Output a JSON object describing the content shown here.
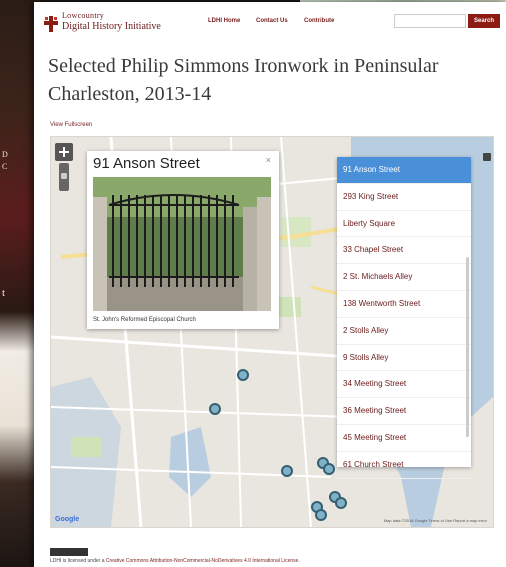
{
  "backdrop": {
    "strip_lines": [
      "D",
      "C",
      "t"
    ]
  },
  "header": {
    "logo_line1": "Lowcountry",
    "logo_line2": "Digital History Initiative",
    "nav": [
      "LDHI Home",
      "Contact Us",
      "Contribute"
    ],
    "search_placeholder": "",
    "search_button": "Search"
  },
  "page": {
    "title": "Selected Philip Simmons Ironwork in Peninsular Charleston, 2013-14",
    "fullscreen_link": "View Fullscreen"
  },
  "map": {
    "popup": {
      "title": "91 Anson Street",
      "close": "×",
      "caption": "St. John's Reformed Episcopal Church"
    },
    "locations": [
      "91 Anson Street",
      "293 King Street",
      "Liberty Square",
      "33 Chapel Street",
      "2 St. Michaels Alley",
      "138 Wentworth Street",
      "2 Stolls Alley",
      "9 Stolls Alley",
      "34 Meeting Street",
      "36 Meeting Street",
      "45 Meeting Street",
      "61 Church Street"
    ],
    "active_index": 0,
    "google_logo": "Google",
    "terms": "Map data ©2016 Google   Terms of Use   Report a map error"
  },
  "footer": {
    "text_prefix": "LDHI is licensed under a ",
    "license_link": "Creative Commons Attribution-NonCommercial-NoDerivatives 4.0 International License",
    "text_suffix": "."
  },
  "colors": {
    "brand": "#8c1c13",
    "link": "#7a1f1f",
    "active": "#4a90d9",
    "marker": "#7fb2c9"
  }
}
